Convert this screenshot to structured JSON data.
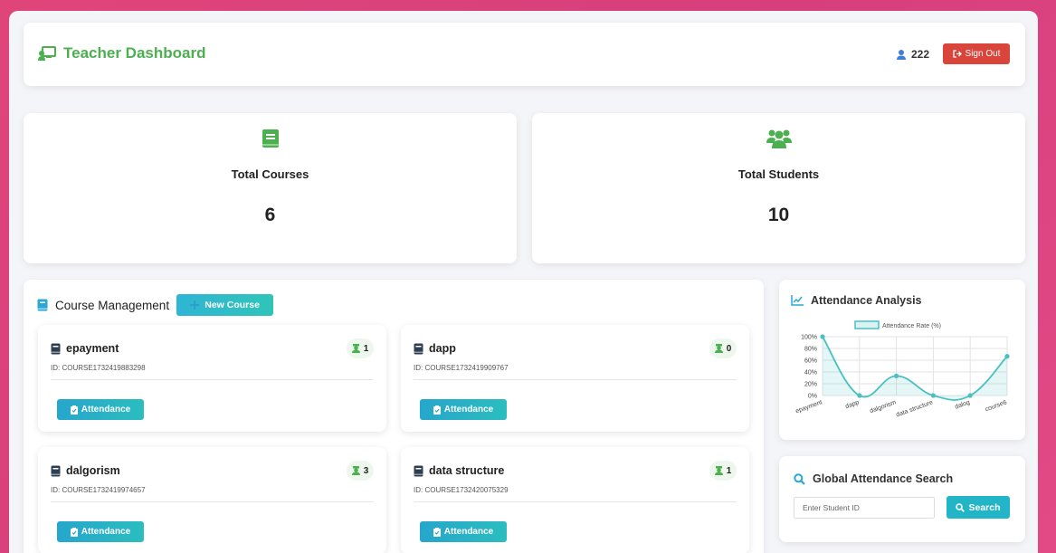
{
  "header": {
    "title": "Teacher Dashboard",
    "user_id": "222",
    "sign_out_label": "Sign Out"
  },
  "stats": {
    "courses": {
      "label": "Total Courses",
      "value": "6"
    },
    "students": {
      "label": "Total Students",
      "value": "10"
    }
  },
  "course_management": {
    "title": "Course Management",
    "new_course_label": "New Course",
    "attendance_label": "Attendance",
    "courses": [
      {
        "name": "epayment",
        "id": "ID: COURSE1732419883298",
        "students": "1"
      },
      {
        "name": "dapp",
        "id": "ID: COURSE1732419909767",
        "students": "0"
      },
      {
        "name": "dalgorism",
        "id": "ID: COURSE1732419974657",
        "students": "3"
      },
      {
        "name": "data structure",
        "id": "ID: COURSE1732420075329",
        "students": "1"
      }
    ]
  },
  "analysis": {
    "title": "Attendance Analysis"
  },
  "search": {
    "title": "Global Attendance Search",
    "placeholder": "Enter Student ID",
    "button_label": "Search"
  },
  "colors": {
    "brand_green": "#4caf50",
    "sign_out_red": "#d9453a",
    "accent_teal": "#22b5c8",
    "chart_line": "#4bc0c0"
  },
  "chart_data": {
    "type": "line",
    "categories": [
      "epayment",
      "dapp",
      "dalgorism",
      "data structure",
      "dalog",
      "course6"
    ],
    "series": [
      {
        "name": "Attendance Rate (%)",
        "values": [
          100,
          0,
          33.3,
          0,
          0,
          66.7
        ]
      }
    ],
    "ylim": [
      0,
      100
    ],
    "yticks": [
      "0%",
      "20%",
      "40%",
      "60%",
      "80%",
      "100%"
    ],
    "legend": "top",
    "grid": true
  }
}
